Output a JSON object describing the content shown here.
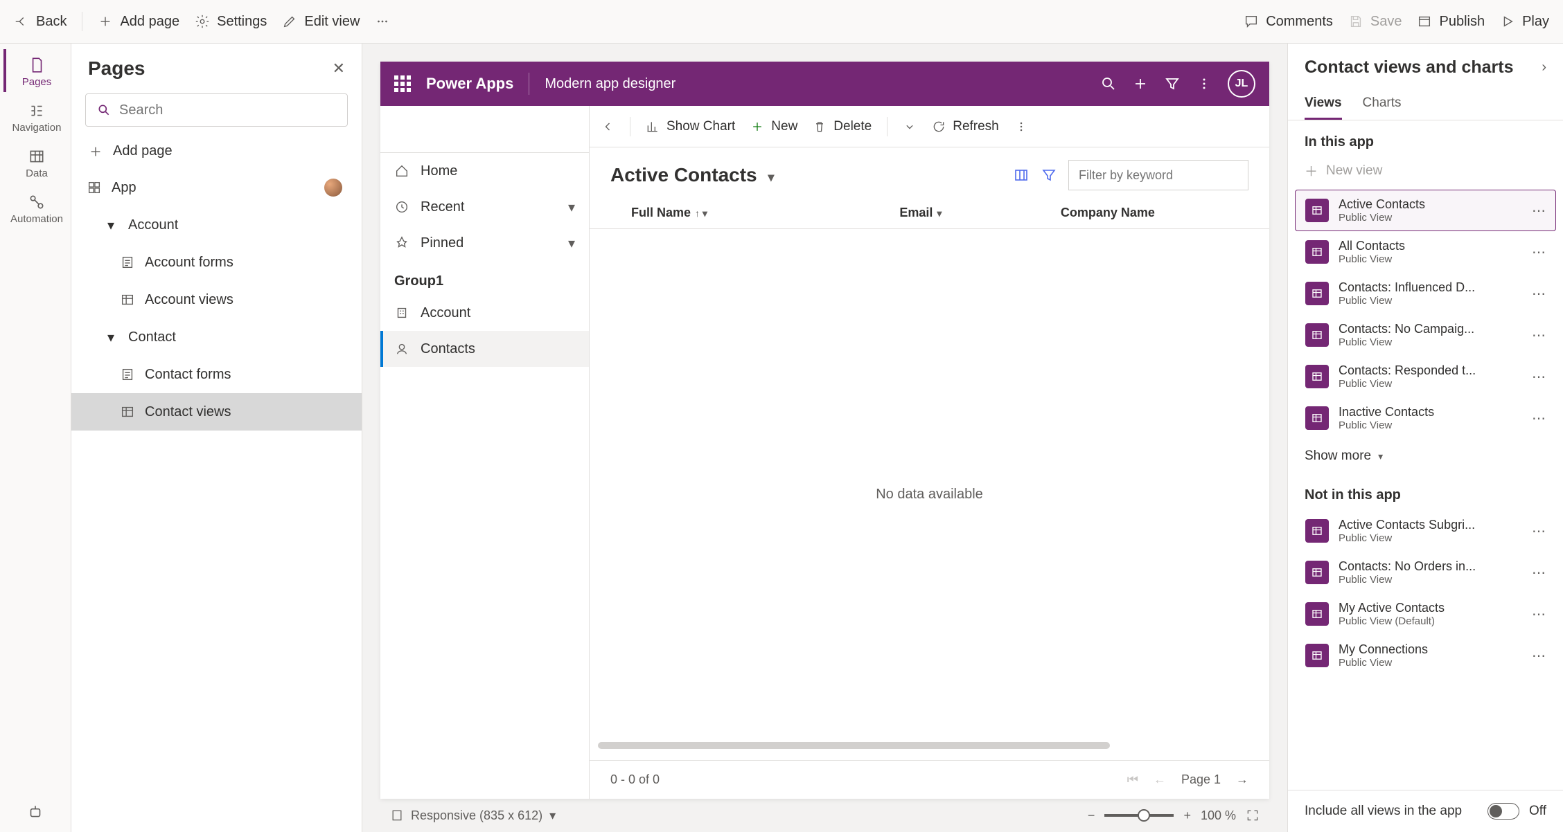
{
  "topbar": {
    "back": "Back",
    "add_page": "Add page",
    "settings": "Settings",
    "edit_view": "Edit view",
    "comments": "Comments",
    "save": "Save",
    "publish": "Publish",
    "play": "Play"
  },
  "rail": {
    "pages": "Pages",
    "navigation": "Navigation",
    "data": "Data",
    "automation": "Automation"
  },
  "pages_panel": {
    "title": "Pages",
    "search_placeholder": "Search",
    "add_page": "Add page",
    "app": "App",
    "account": "Account",
    "account_forms": "Account forms",
    "account_views": "Account views",
    "contact": "Contact",
    "contact_forms": "Contact forms",
    "contact_views": "Contact views"
  },
  "preview": {
    "brand": "Power Apps",
    "app_name": "Modern app designer",
    "avatar": "JL",
    "nav": {
      "home": "Home",
      "recent": "Recent",
      "pinned": "Pinned",
      "group": "Group1",
      "account": "Account",
      "contacts": "Contacts"
    },
    "cmd": {
      "show_chart": "Show Chart",
      "new": "New",
      "delete": "Delete",
      "refresh": "Refresh"
    },
    "view_title": "Active Contacts",
    "filter_placeholder": "Filter by keyword",
    "cols": {
      "full_name": "Full Name",
      "email": "Email",
      "company": "Company Name"
    },
    "no_data": "No data available",
    "row_count": "0 - 0 of 0",
    "page": "Page 1"
  },
  "status": {
    "responsive": "Responsive (835 x 612)",
    "zoom": "100 %"
  },
  "right": {
    "title": "Contact views and charts",
    "tab_views": "Views",
    "tab_charts": "Charts",
    "in_this_app": "In this app",
    "new_view": "New view",
    "in_app_items": [
      {
        "name": "Active Contacts",
        "sub": "Public View",
        "selected": true
      },
      {
        "name": "All Contacts",
        "sub": "Public View"
      },
      {
        "name": "Contacts: Influenced D...",
        "sub": "Public View"
      },
      {
        "name": "Contacts: No Campaig...",
        "sub": "Public View"
      },
      {
        "name": "Contacts: Responded t...",
        "sub": "Public View"
      },
      {
        "name": "Inactive Contacts",
        "sub": "Public View"
      }
    ],
    "show_more": "Show more",
    "not_in_app": "Not in this app",
    "not_in_app_items": [
      {
        "name": "Active Contacts Subgri...",
        "sub": "Public View"
      },
      {
        "name": "Contacts: No Orders in...",
        "sub": "Public View"
      },
      {
        "name": "My Active Contacts",
        "sub": "Public View (Default)"
      },
      {
        "name": "My Connections",
        "sub": "Public View"
      }
    ],
    "include_all": "Include all views in the app",
    "include_all_state": "Off"
  }
}
